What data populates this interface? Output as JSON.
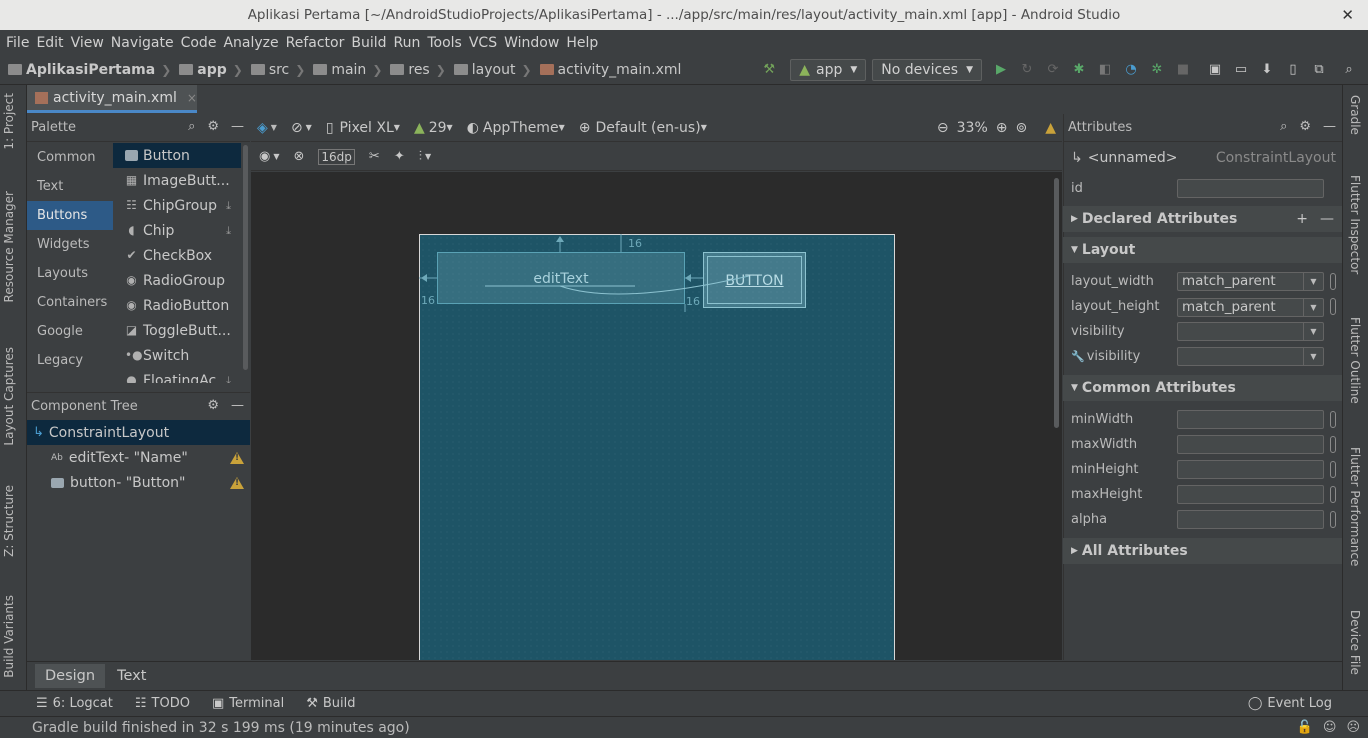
{
  "window": {
    "title": "Aplikasi Pertama [~/AndroidStudioProjects/AplikasiPertama] - .../app/src/main/res/layout/activity_main.xml [app] - Android Studio",
    "close": "✕"
  },
  "menu": [
    "File",
    "Edit",
    "View",
    "Navigate",
    "Code",
    "Analyze",
    "Refactor",
    "Build",
    "Run",
    "Tools",
    "VCS",
    "Window",
    "Help"
  ],
  "breadcrumb": [
    "AplikasiPertama",
    "app",
    "src",
    "main",
    "res",
    "layout",
    "activity_main.xml"
  ],
  "run_config": {
    "module": "app",
    "device": "No devices"
  },
  "file_tab": {
    "label": "activity_main.xml",
    "close": "×"
  },
  "palette": {
    "title": "Palette",
    "categories": [
      "Common",
      "Text",
      "Buttons",
      "Widgets",
      "Layouts",
      "Containers",
      "Google",
      "Legacy"
    ],
    "selected_category": "Buttons",
    "widgets": [
      "Button",
      "ImageButt...",
      "ChipGroup",
      "Chip",
      "CheckBox",
      "RadioGroup",
      "RadioButton",
      "ToggleButt...",
      "Switch",
      "FloatingAc..."
    ]
  },
  "component_tree": {
    "title": "Component Tree",
    "root": "ConstraintLayout",
    "children": [
      {
        "name": "editText",
        "detail": "- \"Name\""
      },
      {
        "name": "button",
        "detail": "- \"Button\""
      }
    ]
  },
  "design_toolbar": {
    "device": "Pixel XL",
    "api": "29",
    "theme": "AppTheme",
    "locale": "Default (en-us)",
    "zoom": "33%",
    "margin": "16dp"
  },
  "canvas": {
    "edittext_label": "editText",
    "button_label": "BUTTON",
    "margin_labels": [
      "16",
      "16",
      "16"
    ]
  },
  "attributes": {
    "title": "Attributes",
    "component_name": "<unnamed>",
    "component_type": "ConstraintLayout",
    "id_label": "id",
    "sections": {
      "declared": "Declared Attributes",
      "layout": "Layout",
      "common": "Common Attributes",
      "all": "All Attributes"
    },
    "layout_rows": [
      {
        "label": "layout_width",
        "value": "match_parent"
      },
      {
        "label": "layout_height",
        "value": "match_parent"
      },
      {
        "label": "visibility",
        "value": ""
      },
      {
        "label": "visibility",
        "value": ""
      }
    ],
    "common_rows": [
      "minWidth",
      "maxWidth",
      "minHeight",
      "maxHeight",
      "alpha"
    ]
  },
  "left_tool_tabs": [
    "1: Project",
    "Resource Manager",
    "Layout Captures",
    "Z: Structure",
    "Build Variants"
  ],
  "right_tool_tabs": [
    "Gradle",
    "Flutter Inspector",
    "Flutter Outline",
    "Flutter Performance",
    "Device File"
  ],
  "editor_tabs": {
    "design": "Design",
    "text": "Text"
  },
  "tool_windows": [
    "6: Logcat",
    "TODO",
    "Terminal",
    "Build"
  ],
  "event_log": "Event Log",
  "status": "Gradle build finished in 32 s 199 ms (19 minutes ago)"
}
